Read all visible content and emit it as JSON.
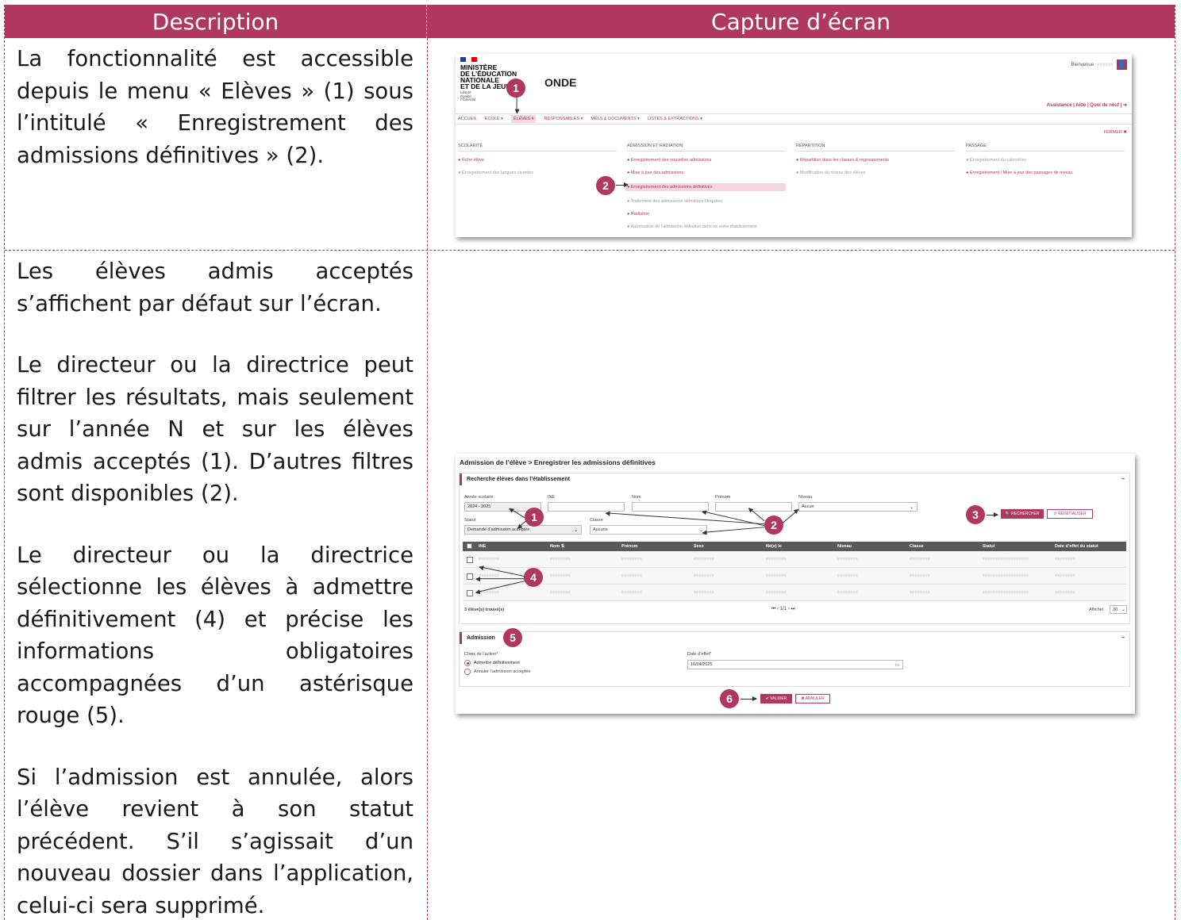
{
  "header": {
    "description": "Description",
    "capture": "Capture d’écran"
  },
  "row1": {
    "text": "La fonctionnalité est accessible depuis le menu « Elèves » (1) sous l’intitulé « Enregistrement des admissions définitives » (2)."
  },
  "row2": {
    "paragraphs": [
      "Les élèves admis acceptés s’affichent par défaut sur l’écran.",
      "Le directeur ou la directrice peut filtrer les résultats, mais seulement sur l’année N et sur les élèves admis acceptés (1). D’autres filtres sont disponibles (2).",
      "Le directeur ou la directrice sélectionne les élèves à admettre définitivement (4) et précise les informations obligatoires accompagnées d’un astérisque rouge (5).",
      "Si l’admission est annulée, alors l’élève revient à son statut précédent. S’il s’agissait d’un nouveau dossier dans l’application, celui-ci sera supprimé."
    ]
  },
  "shot1": {
    "ministry": [
      "MINISTÈRE",
      "DE L’ÉDUCATION",
      "NATIONALE",
      "ET DE LA JEUN"
    ],
    "motto": [
      "Liberté",
      "Égalité",
      "Fraternité"
    ],
    "app_name": "ONDE",
    "welcome": "Bienvenue",
    "top_links": "Assistance | Aide | Quoi de neuf |",
    "menu": [
      "ACCUEIL",
      "ÉCOLE ▾",
      "ÉLÈVES ▾",
      "RESPONSABLES ▾",
      "MÉLS & DOCUMENTS ▾",
      "LISTES & EXTRACTIONS ▾"
    ],
    "close": "FERMER ✖",
    "columns": [
      {
        "title": "SCOLARITÉ",
        "items": [
          "● Fiche élève",
          "● Enregistrement des langues vivantes"
        ]
      },
      {
        "title": "ADMISSION ET RADIATION",
        "items": [
          "● Enregistrement des nouvelles admissions",
          "● Mise à jour des admissions",
          "● Enregistrement des admissions définitives",
          "● Traitement des admissions définitives bloquées",
          "● Radiation",
          "● Autorisation de l’admission définitive dans un autre établissement"
        ]
      },
      {
        "title": "RÉPARTITION",
        "items": [
          "● Répartition dans les classes & regroupements",
          "● Modification du niveau des élèves"
        ]
      },
      {
        "title": "PASSAGE",
        "items": [
          "● Enregistrement du calendrier",
          "● Enregistrement / Mise à jour des passages de niveau"
        ]
      }
    ]
  },
  "shot2": {
    "title": "Admission de l’élève > Enregistrer les admissions définitives",
    "search_panel": "Recherche élèves dans l’établissement",
    "labels": {
      "year": "Année scolaire",
      "ine": "INE",
      "nom": "Nom",
      "prenom": "Prénom",
      "niveau": "Niveau",
      "statut": "Statut",
      "classe": "Classe"
    },
    "values": {
      "year": "2024 - 2025",
      "niveau": "Aucun",
      "statut": "Demande d’admission acceptée",
      "classe": "Aucune"
    },
    "search_btn": "🔍 RECHERCHER",
    "reset_btn": "↺ RÉINITIALISER",
    "columns": [
      "INE",
      "Nom ⇅",
      "Prénom",
      "Sexe",
      "Né(e) le",
      "Niveau",
      "Classe",
      "Statut",
      "Date d’effet du statut"
    ],
    "rows": [
      [
        "xxxxxxxx",
        "xxxxxxxx",
        "xxxxxxxx",
        "xxxxxxxx",
        "xxxxxxxx",
        "xxxxxxxx",
        "xxxxxxxx",
        "xxxxxxxxxxxxxxxxxx",
        "xxxxxxxx"
      ],
      [
        "xxxxxxxx",
        "xxxxxxxx",
        "xxxxxxxx",
        "xxxxxxxx",
        "xxxxxxxx",
        "xxxxxxxx",
        "xxxxxxxx",
        "xxxxxxxxxxxxxxxxxx",
        "xxxxxxxx"
      ],
      [
        "xxxxxxxx",
        "xxxxxxxx",
        "xxxxxxxx",
        "xxxxxxxx",
        "xxxxxxxx",
        "xxxxxxxx",
        "xxxxxxxx",
        "xxxxxxxxxxxxxxxxxx",
        "xxxxxxxx"
      ]
    ],
    "found": "3 élève(s) trouvé(s)",
    "pager": "⏮  ‹  1/1  ›  ⏭",
    "show_label": "Afficher",
    "show_value": "30",
    "admission_panel": "Admission",
    "action_label": "Choix de l’action",
    "date_label": "Date d’effet",
    "options": [
      "Admettre définitivement",
      "Annuler l’admission acceptée"
    ],
    "date_value": "16/04/2025",
    "validate": "✔ VALIDER",
    "cancel": "✖ ANNULER"
  },
  "badges": [
    "1",
    "2",
    "3",
    "4",
    "5",
    "6"
  ]
}
